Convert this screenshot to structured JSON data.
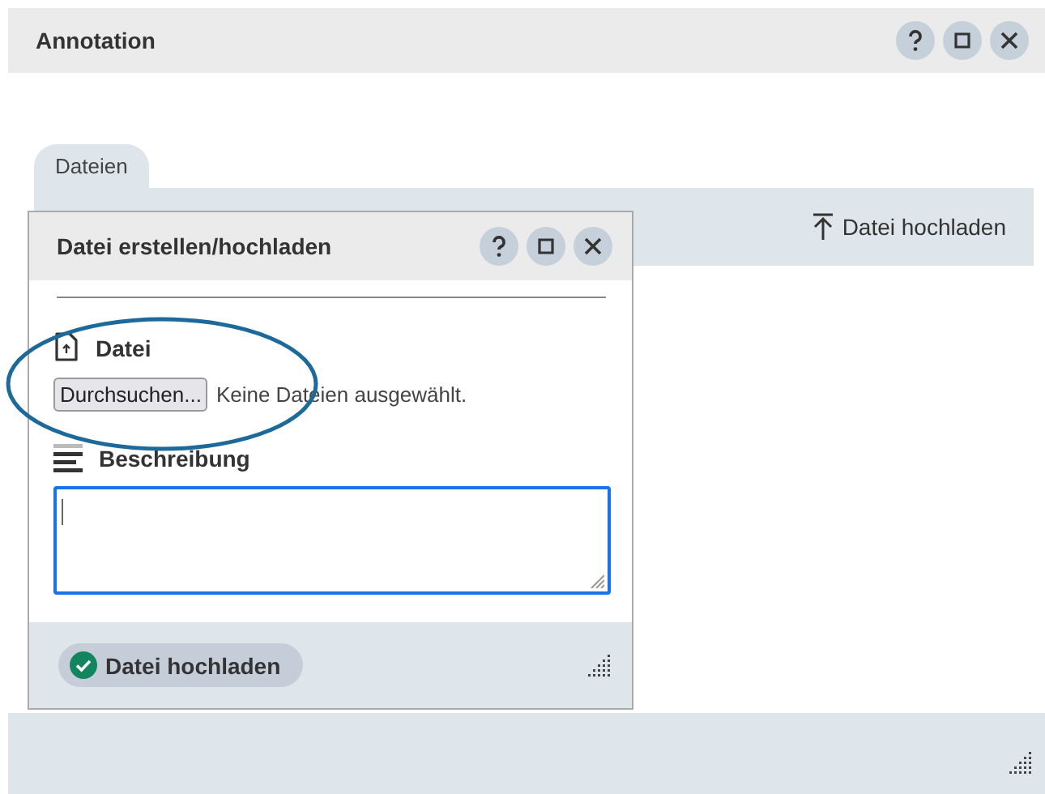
{
  "window": {
    "title": "Annotation",
    "controls": [
      {
        "kind": "help"
      },
      {
        "kind": "restore"
      },
      {
        "kind": "close"
      }
    ]
  },
  "tabs": [
    {
      "label": "Dateien",
      "selected": true
    }
  ],
  "toolbar": {
    "upload_action": "Datei hochladen"
  },
  "dialog": {
    "title": "Datei erstellen/hochladen",
    "controls": [
      {
        "kind": "help"
      },
      {
        "kind": "restore"
      },
      {
        "kind": "close"
      }
    ],
    "file_label": "Datei",
    "browse_button": "Durchsuchen...",
    "file_status": "Keine Dateien ausgewählt.",
    "description_label": "Beschreibung",
    "description_field": {
      "focused": true
    },
    "submit_button": "Datei hochladen"
  }
}
